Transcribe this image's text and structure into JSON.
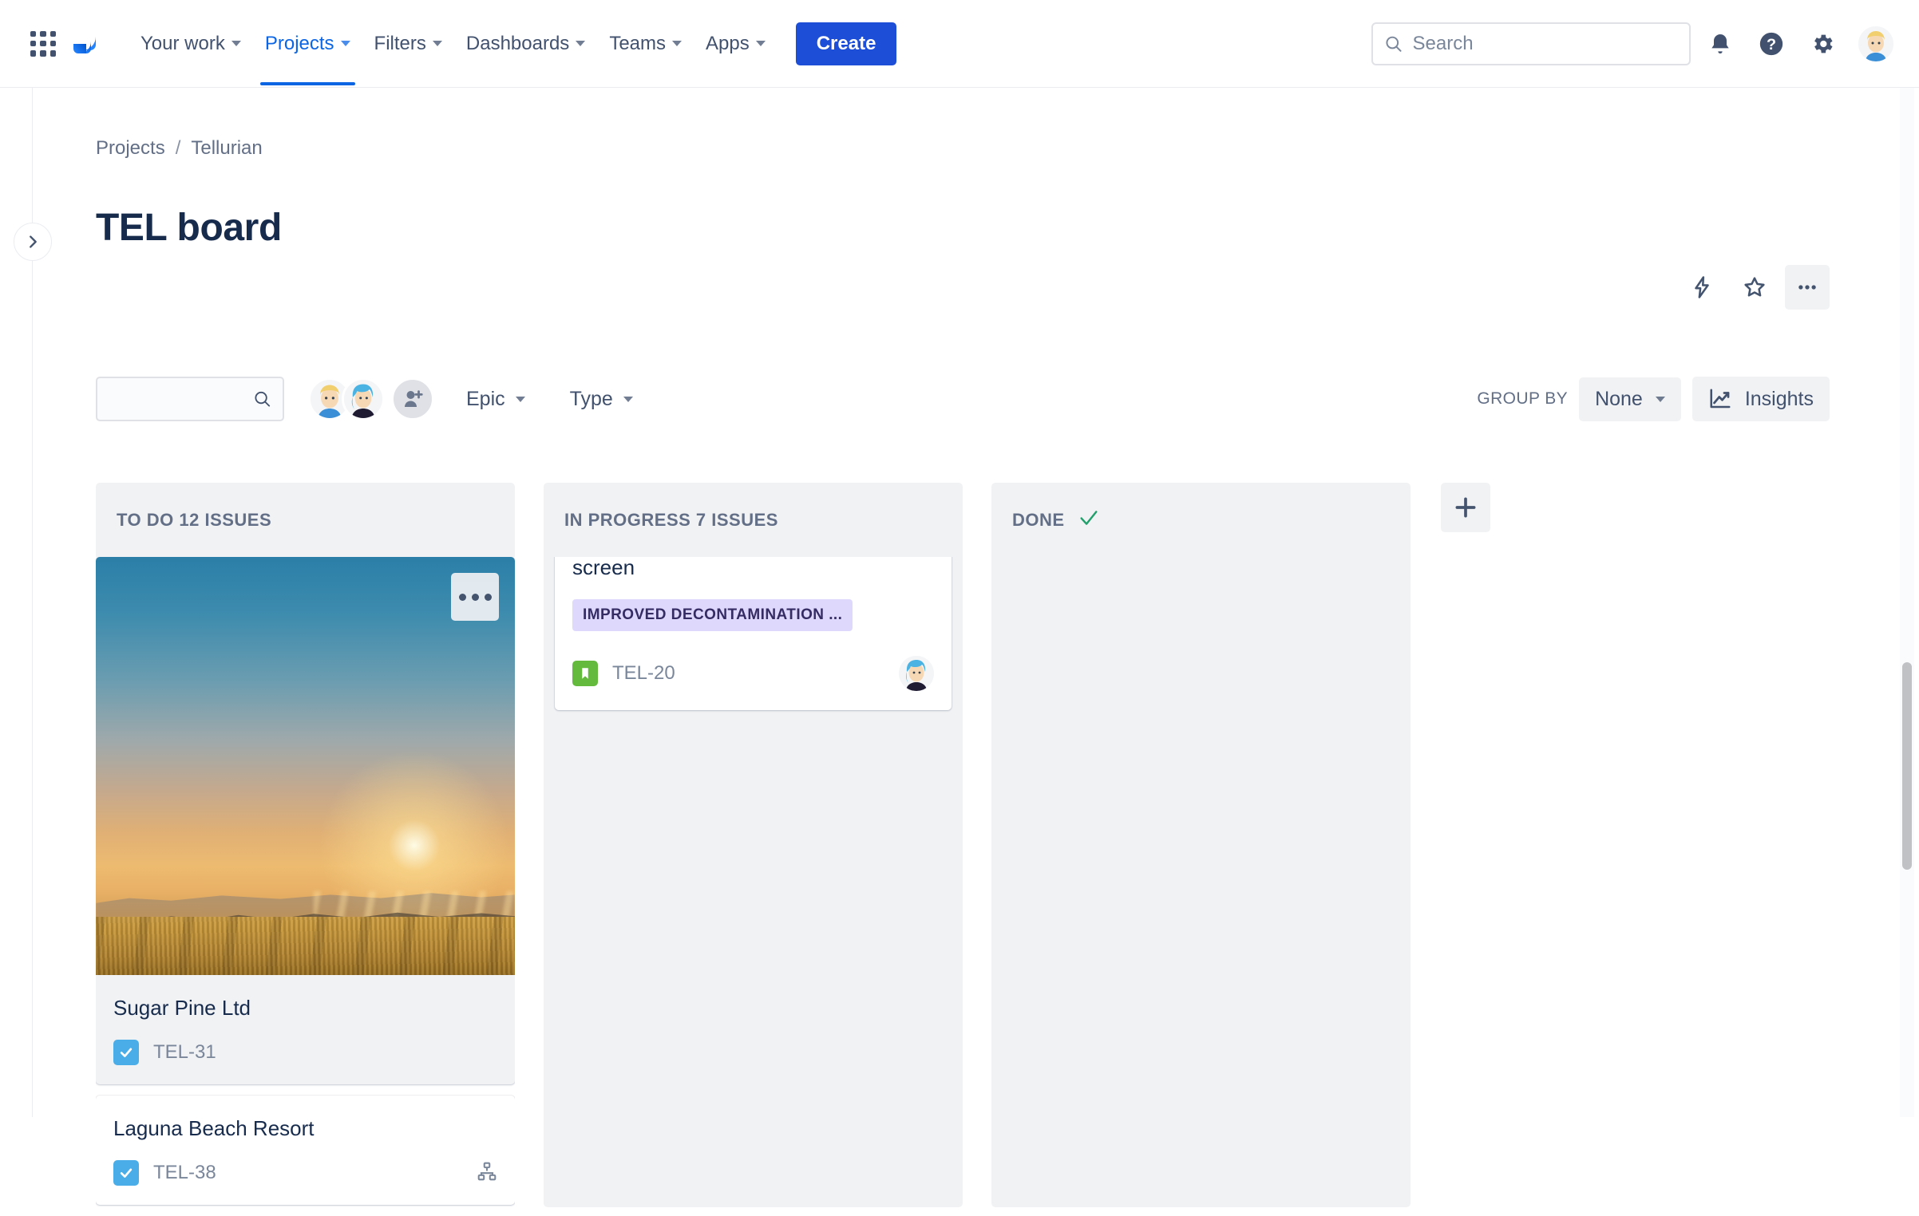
{
  "nav": {
    "app_switcher": "app-switcher-icon",
    "logo": "jira-logo",
    "items": [
      {
        "label": "Your work",
        "has_caret": true,
        "active": false
      },
      {
        "label": "Projects",
        "has_caret": true,
        "active": true
      },
      {
        "label": "Filters",
        "has_caret": true,
        "active": false
      },
      {
        "label": "Dashboards",
        "has_caret": true,
        "active": false
      },
      {
        "label": "Teams",
        "has_caret": true,
        "active": false
      },
      {
        "label": "Apps",
        "has_caret": true,
        "active": false
      }
    ],
    "create_label": "Create",
    "search_placeholder": "Search",
    "search_value": "",
    "icons": [
      "notifications-icon",
      "help-icon",
      "settings-icon",
      "profile-avatar"
    ]
  },
  "breadcrumb": {
    "items": [
      "Projects",
      "Tellurian"
    ],
    "separator": "/"
  },
  "header": {
    "title": "TEL board",
    "actions": [
      "automation-icon",
      "star-icon",
      "more-actions-icon"
    ]
  },
  "toolbar": {
    "search_value": "",
    "search_placeholder": "",
    "avatars": [
      "member-1",
      "member-2"
    ],
    "add_people_label": "add-people-icon",
    "filters": [
      {
        "label": "Epic"
      },
      {
        "label": "Type"
      }
    ],
    "group_by_label": "GROUP BY",
    "group_by_value": "None",
    "insights_label": "Insights"
  },
  "board": {
    "columns": [
      {
        "id": "todo",
        "title": "TO DO 12 ISSUES",
        "status_name": "TO DO",
        "issue_count": "12 ISSUES",
        "done": false,
        "cards": [
          {
            "title": "Sugar Pine Ltd",
            "key": "TEL-31",
            "type": "task",
            "selected": true,
            "has_cover": true,
            "cover": "sunset-wheat-field",
            "epic": "",
            "assignee": "",
            "child_issues": false
          },
          {
            "title": "Laguna Beach Resort",
            "key": "TEL-38",
            "type": "task",
            "selected": false,
            "has_cover": false,
            "cover": "",
            "epic": "",
            "assignee": "",
            "child_issues": true
          }
        ]
      },
      {
        "id": "inprogress",
        "title": "IN PROGRESS 7 ISSUES",
        "status_name": "IN PROGRESS",
        "issue_count": "7 ISSUES",
        "done": false,
        "cards": [
          {
            "title": "screen",
            "key": "TEL-20",
            "type": "story",
            "selected": false,
            "has_cover": false,
            "cover": "",
            "epic": "IMPROVED DECONTAMINATION ...",
            "assignee": "member-2",
            "child_issues": false,
            "clipped_top": true
          }
        ]
      },
      {
        "id": "done",
        "title": "DONE",
        "status_name": "DONE",
        "issue_count": "",
        "done": true,
        "cards": []
      }
    ],
    "add_column_label": "add-column-icon"
  },
  "colors": {
    "brand_blue": "#1d4ed8",
    "link_blue": "#0c66e4",
    "text_dark": "#172b4d",
    "text_muted": "#626f86",
    "column_bg": "#f1f2f4",
    "epic_bg": "#dfd8fd",
    "epic_text": "#352c63",
    "done_check": "#22a06b",
    "task_icon": "#4bade8",
    "story_icon": "#63ba3c"
  }
}
